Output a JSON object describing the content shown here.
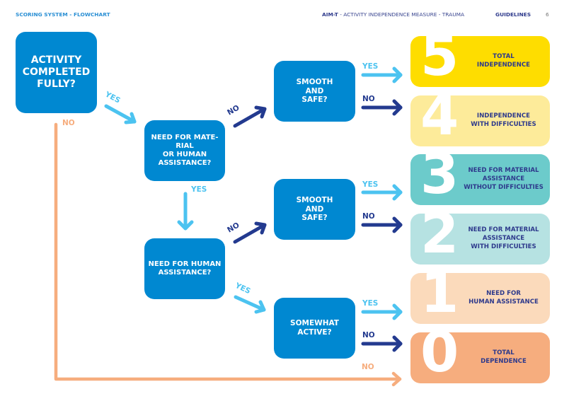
{
  "header": {
    "section_title": "SCORING SYSTEM - FLOWCHART",
    "doc_abbrev": "AIM-T",
    "doc_title": " - ACTIVITY INDEPENDENCE MEASURE - TRAUMA",
    "section": "GUIDELINES",
    "page_number": "6"
  },
  "colors": {
    "question_box": "#0088d1",
    "yes_arrow": "#4cc3f0",
    "no_arrow": "#233a8f",
    "fail_arrow": "#f6ad7e",
    "label_text": "#2e3a8c"
  },
  "questions": [
    {
      "id": "q1",
      "lines": [
        "ACTIVITY",
        "COMPLETED",
        "FULLY?"
      ]
    },
    {
      "id": "q2",
      "lines": [
        "NEED FOR MATE-",
        "RIAL",
        "OR HUMAN",
        "ASSISTANCE?"
      ]
    },
    {
      "id": "q3",
      "lines": [
        "NEED FOR HUMAN",
        "ASSISTANCE?"
      ]
    },
    {
      "id": "q4",
      "lines": [
        "SMOOTH",
        "AND",
        "SAFE?"
      ]
    },
    {
      "id": "q5",
      "lines": [
        "SMOOTH",
        "AND",
        "SAFE?"
      ]
    },
    {
      "id": "q6",
      "lines": [
        "SOMEWHAT",
        "ACTIVE?"
      ]
    }
  ],
  "scores": [
    {
      "score": "5",
      "lines": [
        "TOTAL",
        "INDEPENDENCE"
      ],
      "color": "#fedd00"
    },
    {
      "score": "4",
      "lines": [
        "INDEPENDENCE",
        "WITH DIFFICULTIES"
      ],
      "color": "#fdeb9a"
    },
    {
      "score": "3",
      "lines": [
        "NEED FOR MATERIAL",
        "ASSISTANCE",
        "WITHOUT DIFFICULTIES"
      ],
      "color": "#6ccbcb"
    },
    {
      "score": "2",
      "lines": [
        "NEED FOR MATERIAL",
        "ASSISTANCE",
        "WITH DIFFICULTIES"
      ],
      "color": "#b6e2e2"
    },
    {
      "score": "1",
      "lines": [
        "NEED FOR",
        "HUMAN ASSISTANCE"
      ],
      "color": "#fbdabb"
    },
    {
      "score": "0",
      "lines": [
        "TOTAL",
        "DEPENDENCE"
      ],
      "color": "#f6ad7e"
    }
  ],
  "edges": {
    "yes": "YES",
    "no": "NO"
  }
}
